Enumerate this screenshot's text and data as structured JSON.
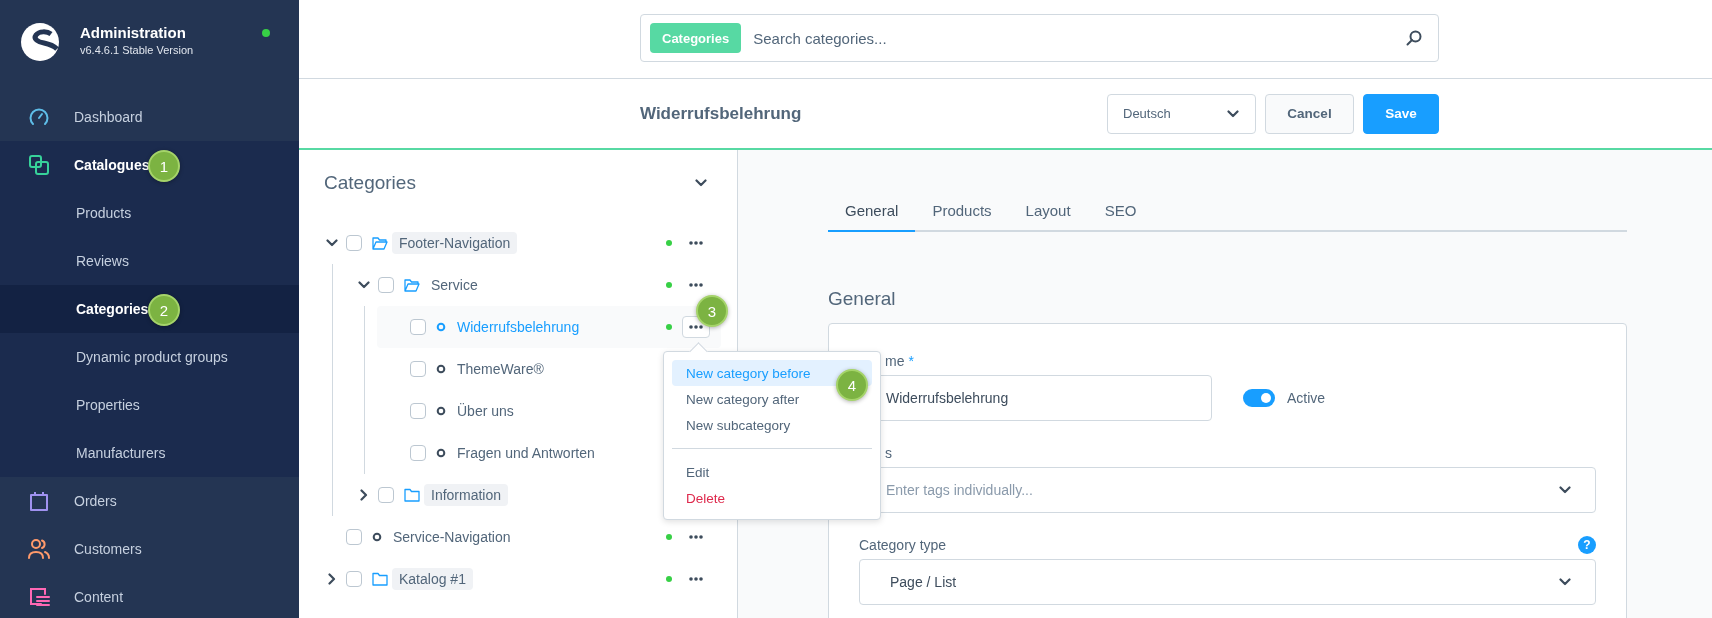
{
  "sidebar": {
    "title": "Administration",
    "version": "v6.4.6.1 Stable Version",
    "online": true,
    "items": [
      {
        "label": "Dashboard",
        "color": "#5ebde8"
      },
      {
        "label": "Catalogues",
        "color": "#37d29a",
        "expanded": true,
        "children": [
          {
            "label": "Products",
            "selected": false
          },
          {
            "label": "Reviews",
            "selected": false
          },
          {
            "label": "Categories",
            "selected": true
          },
          {
            "label": "Dynamic product groups",
            "selected": false
          },
          {
            "label": "Properties",
            "selected": false
          },
          {
            "label": "Manufacturers",
            "selected": false
          }
        ]
      },
      {
        "label": "Orders",
        "color": "#a092f0"
      },
      {
        "label": "Customers",
        "color": "#ff9a6b"
      },
      {
        "label": "Content",
        "color": "#ff68b4"
      }
    ]
  },
  "search": {
    "tag": "Categories",
    "placeholder": "Search categories..."
  },
  "smart_bar": {
    "title": "Widerrufsbelehrung",
    "language": "Deutsch",
    "buttons": [
      {
        "label": "Cancel",
        "kind": "secondary"
      },
      {
        "label": "Save",
        "kind": "primary"
      }
    ]
  },
  "tree": {
    "title": "Categories",
    "items": [
      {
        "label": "Footer-Navigation",
        "kind": "folder",
        "expanded": true,
        "checked": false,
        "pill": true,
        "selected": false,
        "active": true,
        "children": [
          {
            "label": "Service",
            "kind": "folder",
            "expanded": true,
            "checked": false,
            "pill": false,
            "selected": false,
            "active": true,
            "children": [
              {
                "label": "Widerrufsbelehrung",
                "kind": "leaf",
                "checked": false,
                "pill": false,
                "selected": true,
                "active": true
              },
              {
                "label": "ThemeWare®",
                "kind": "leaf",
                "checked": false,
                "pill": false,
                "selected": false
              },
              {
                "label": "Über uns",
                "kind": "leaf",
                "checked": false,
                "pill": false,
                "selected": false
              },
              {
                "label": "Fragen und Antworten",
                "kind": "leaf",
                "checked": false,
                "pill": false,
                "selected": false
              }
            ]
          },
          {
            "label": "Information",
            "kind": "folder",
            "expanded": false,
            "checked": false,
            "pill": true,
            "selected": false
          }
        ]
      },
      {
        "label": "Service-Navigation",
        "kind": "leaf",
        "checked": false,
        "pill": false,
        "selected": false,
        "active": true
      },
      {
        "label": "Katalog #1",
        "kind": "folder",
        "expanded": false,
        "checked": false,
        "pill": true,
        "selected": false,
        "active": true
      }
    ]
  },
  "detail": {
    "tabs": [
      {
        "label": "General",
        "selected": true
      },
      {
        "label": "Products",
        "selected": false
      },
      {
        "label": "Layout",
        "selected": false
      },
      {
        "label": "SEO",
        "selected": false
      }
    ],
    "section_title": "General",
    "fields": [
      {
        "kind": "text",
        "label": "me",
        "required_mark": "*",
        "value": "Widerrufsbelehrung",
        "toggle": {
          "label": "Active",
          "on": true
        }
      },
      {
        "kind": "select",
        "label": "s",
        "placeholder": "Enter tags individually..."
      },
      {
        "kind": "select",
        "label": "Category type",
        "help": "?",
        "value": "Page / List"
      }
    ]
  },
  "context_menu": {
    "items": [
      {
        "label": "New category before",
        "kind": "action",
        "selected": true
      },
      {
        "label": "New category after",
        "kind": "action",
        "selected": false
      },
      {
        "label": "New subcategory",
        "kind": "action",
        "selected": false
      },
      {
        "label": "Edit",
        "kind": "action",
        "selected": false,
        "separator_before": true
      },
      {
        "label": "Delete",
        "kind": "danger",
        "selected": false
      }
    ]
  },
  "annotations": [
    {
      "label": "1"
    },
    {
      "label": "2"
    },
    {
      "label": "3"
    },
    {
      "label": "4"
    }
  ]
}
